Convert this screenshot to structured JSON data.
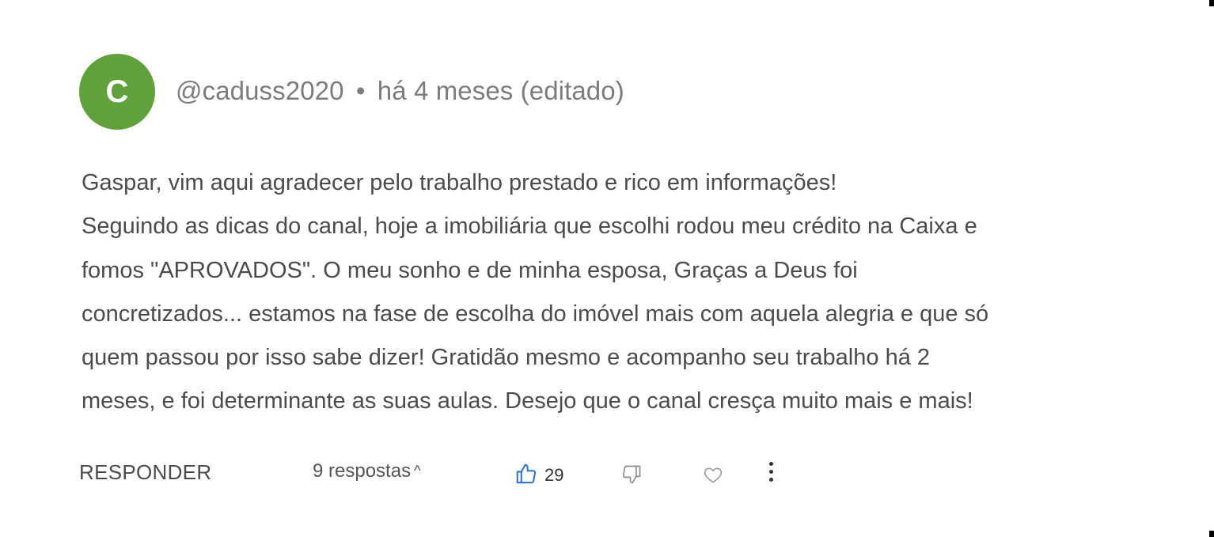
{
  "avatar": {
    "initial": "C",
    "color": "#5fa13a"
  },
  "comment": {
    "author": "@caduss2020",
    "separator": "•",
    "time": "há 4 meses (editado)",
    "lines": [
      "Gaspar, vim aqui agradecer pelo trabalho prestado e rico em informações!",
      "Seguindo as dicas do canal, hoje a imobiliária que escolhi rodou meu crédito na Caixa e",
      "fomos \"APROVADOS\". O meu sonho e de minha esposa, Graças a Deus foi",
      "concretizados... estamos na fase de escolha do imóvel mais com aquela alegria e que só",
      "quem passou por isso sabe dizer! Gratidão mesmo e acompanho seu trabalho há 2",
      "meses, e foi determinante as suas aulas. Desejo que o canal cresça muito mais e mais!"
    ]
  },
  "actions": {
    "reply_label": "RESPONDER",
    "replies_label": "9 respostas",
    "replies_chevron": "^",
    "like_icon": "thumbs-up-icon",
    "like_count": "29",
    "dislike_icon": "thumbs-down-icon",
    "heart_icon": "heart-icon",
    "more_icon": "more-vertical-icon",
    "accent_color": "#2a6fd6"
  }
}
